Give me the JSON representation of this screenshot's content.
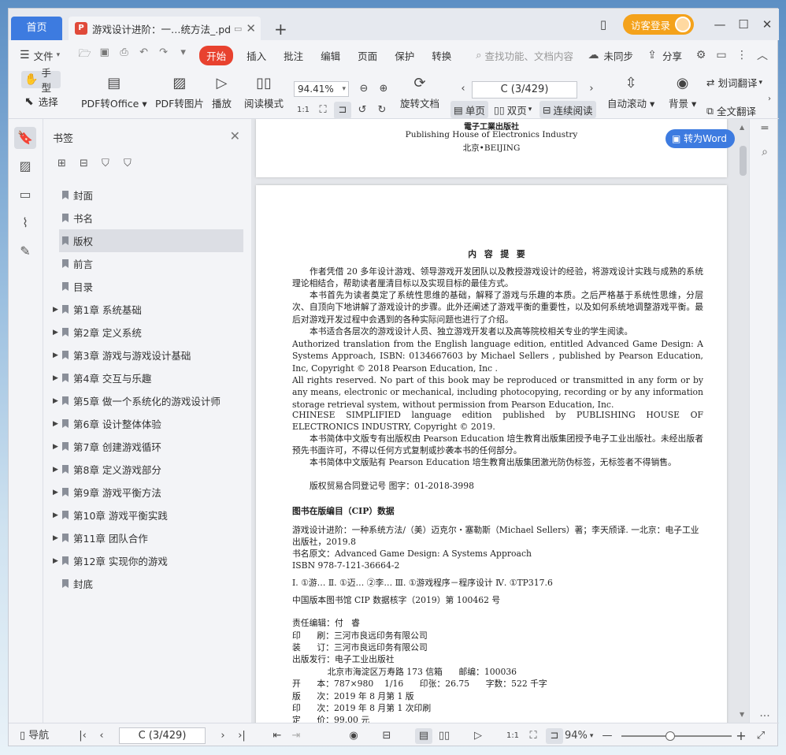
{
  "tabs": {
    "home": "首页",
    "doc_title": "游戏设计进阶：一…统方法_.pdf",
    "login": "访客登录"
  },
  "menu": {
    "file": "文件",
    "start": "开始",
    "items": [
      "插入",
      "批注",
      "编辑",
      "页面",
      "保护",
      "转换"
    ],
    "search_placeholder": "查找功能、文档内容",
    "sync": "未同步",
    "share": "分享"
  },
  "toolbar": {
    "hand": "手型",
    "select": "选择",
    "pdf_to_office": "PDF转Office",
    "pdf_to_image": "PDF转图片",
    "play": "播放",
    "read_mode": "阅读模式",
    "zoom": "94.41%",
    "page_indicator": "C (3/429)",
    "rotate": "旋转文档",
    "single": "单页",
    "double": "双页",
    "continuous": "连续阅读",
    "auto_scroll": "自动滚动",
    "background": "背景",
    "word_translate": "划词翻译",
    "full_translate": "全文翻译"
  },
  "sidebar": {
    "title": "书签",
    "items": [
      {
        "label": "封面",
        "expandable": false
      },
      {
        "label": "书名",
        "expandable": false
      },
      {
        "label": "版权",
        "expandable": false,
        "selected": true
      },
      {
        "label": "前言",
        "expandable": false
      },
      {
        "label": "目录",
        "expandable": false
      },
      {
        "label": "第1章   系统基础",
        "expandable": true
      },
      {
        "label": "第2章   定义系统",
        "expandable": true
      },
      {
        "label": "第3章   游戏与游戏设计基础",
        "expandable": true
      },
      {
        "label": "第4章   交互与乐趣",
        "expandable": true
      },
      {
        "label": "第5章   做一个系统化的游戏设计师",
        "expandable": true
      },
      {
        "label": "第6章   设计整体体验",
        "expandable": true
      },
      {
        "label": "第7章   创建游戏循环",
        "expandable": true
      },
      {
        "label": "第8章   定义游戏部分",
        "expandable": true
      },
      {
        "label": "第9章   游戏平衡方法",
        "expandable": true
      },
      {
        "label": "第10章   游戏平衡实践",
        "expandable": true
      },
      {
        "label": "第11章   团队合作",
        "expandable": true
      },
      {
        "label": "第12章   实现你的游戏",
        "expandable": true
      },
      {
        "label": "封底",
        "expandable": false
      }
    ]
  },
  "document": {
    "to_word": "转为Word",
    "publisher_cn": "電子工業出版社",
    "publisher_en": "Publishing House of Electronics Industry",
    "publisher_city": "北京•BEIJING",
    "summary_title": "内 容 提 要",
    "paragraphs": [
      "作者凭借 20 多年设计游戏、领导游戏开发团队以及教授游戏设计的经验，将游戏设计实践与成熟的系统理论相结合，帮助读者厘清目标以及实现目标的最佳方式。",
      "本书首先为读者奠定了系统性思维的基础，解释了游戏与乐趣的本质。之后严格基于系统性思维，分层次、自顶向下地讲解了游戏设计的步骤。此外还阐述了游戏平衡的重要性，以及如何系统地调整游戏平衡。最后对游戏开发过程中会遇到的各种实际问题也进行了介绍。",
      "本书适合各层次的游戏设计人员、独立游戏开发者以及高等院校相关专业的学生阅读。",
      "Authorized translation from the English language edition, entitled Advanced Game Design: A Systems Approach, ISBN: 0134667603 by Michael Sellers , published by Pearson Education, Inc, Copyright © 2018 Pearson Education, Inc .",
      "All rights reserved. No part of this book may be reproduced or transmitted in any form or by any means, electronic or mechanical, including photocopying, recording or by any information storage retrieval system, without permission from Pearson Education, Inc.",
      "CHINESE SIMPLIFIED language edition published by PUBLISHING HOUSE OF ELECTRONICS INDUSTRY, Copyright © 2019.",
      "本书简体中文版专有出版权由 Pearson Education 培生教育出版集团授予电子工业出版社。未经出版者预先书面许可，不得以任何方式复制或抄袭本书的任何部分。",
      "本书简体中文版贴有 Pearson Education 培生教育出版集团激光防伪标签，无标签者不得销售。"
    ],
    "copyright_reg": "版权贸易合同登记号   图字：01-2018-3998",
    "cip_title": "图书在版编目（CIP）数据",
    "cip_line1": "游戏设计进阶：一种系统方法/（美）迈克尔・塞勒斯（Michael Sellers）著；李天颀译. 一北京：电子工业出版社，2019.8",
    "cip_line2": "书名原文：Advanced Game Design: A Systems Approach",
    "cip_line3": "ISBN 978-7-121-36664-2",
    "cip_line4": "Ⅰ. ①游…  Ⅱ. ①迈…  ②李…  Ⅲ. ①游戏程序－程序设计  Ⅳ. ①TP317.6",
    "cip_line5": "中国版本图书馆 CIP 数据核字（2019）第 100462 号",
    "credits": [
      "责任编辑：付   睿",
      "印      刷：三河市良远印务有限公司",
      "装      订：三河市良远印务有限公司",
      "出版发行：电子工业出版社",
      "             北京市海淀区万寿路 173 信箱      邮编：100036",
      "开      本：787×980    1/16      印张：26.75      字数：522 千字",
      "版      次：2019 年 8 月第 1 版",
      "印      次：2019 年 8 月第 1 次印刷",
      "定      价：99.00 元"
    ]
  },
  "statusbar": {
    "nav": "导航",
    "page_indicator": "C (3/429)",
    "zoom": "94%"
  }
}
